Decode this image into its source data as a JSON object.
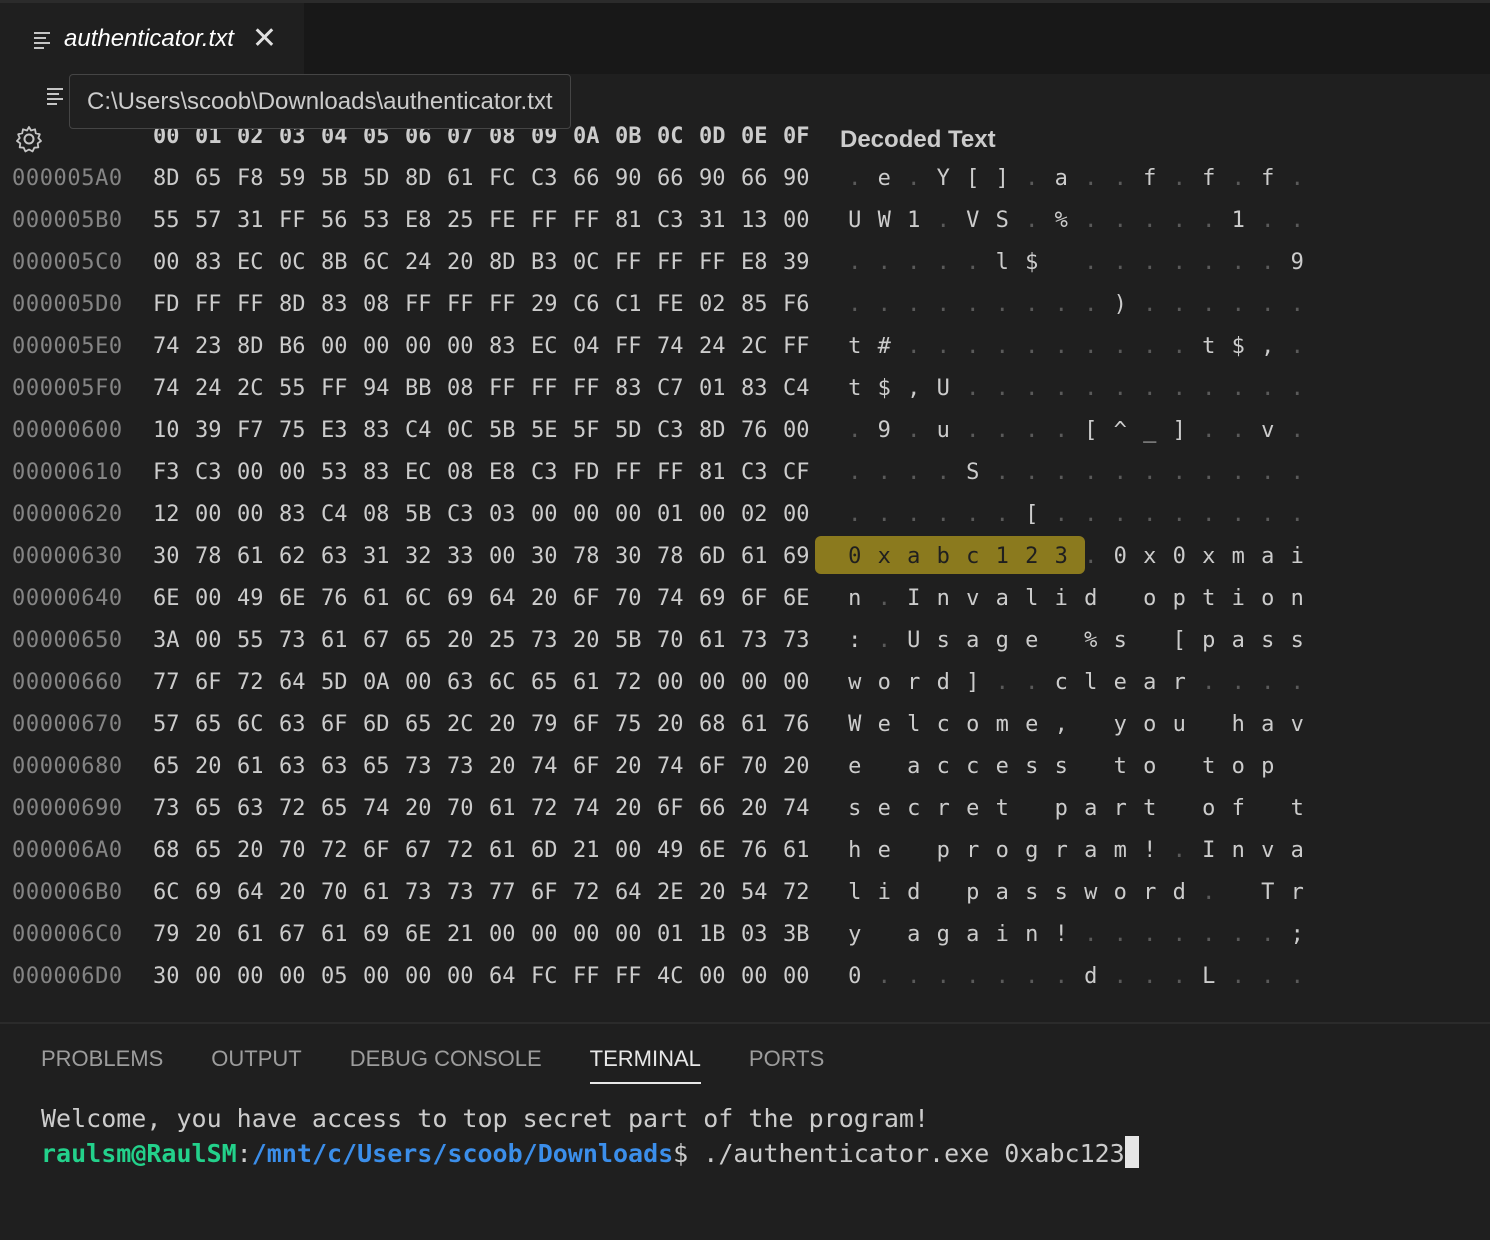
{
  "tab": {
    "title": "authenticator.txt",
    "close_glyph": "✕",
    "icon": "file-lines-icon"
  },
  "tooltip": {
    "path": "C:\\Users\\scoob\\Downloads\\authenticator.txt"
  },
  "hex_header": [
    "00",
    "01",
    "02",
    "03",
    "04",
    "05",
    "06",
    "07",
    "08",
    "09",
    "0A",
    "0B",
    "0C",
    "0D",
    "0E",
    "0F"
  ],
  "decoded_header": "Decoded Text",
  "rows": [
    {
      "addr": "000005A0",
      "hex": [
        "8D",
        "65",
        "F8",
        "59",
        "5B",
        "5D",
        "8D",
        "61",
        "FC",
        "C3",
        "66",
        "90",
        "66",
        "90",
        "66",
        "90"
      ],
      "dec": [
        ".",
        "e",
        ".",
        "Y",
        "[",
        "]",
        ".",
        "a",
        ".",
        ".",
        "f",
        ".",
        "f",
        ".",
        "f",
        "."
      ]
    },
    {
      "addr": "000005B0",
      "hex": [
        "55",
        "57",
        "31",
        "FF",
        "56",
        "53",
        "E8",
        "25",
        "FE",
        "FF",
        "FF",
        "81",
        "C3",
        "31",
        "13",
        "00"
      ],
      "dec": [
        "U",
        "W",
        "1",
        ".",
        "V",
        "S",
        ".",
        "%",
        ".",
        ".",
        ".",
        ".",
        ".",
        "1",
        ".",
        "."
      ]
    },
    {
      "addr": "000005C0",
      "hex": [
        "00",
        "83",
        "EC",
        "0C",
        "8B",
        "6C",
        "24",
        "20",
        "8D",
        "B3",
        "0C",
        "FF",
        "FF",
        "FF",
        "E8",
        "39"
      ],
      "dec": [
        ".",
        ".",
        ".",
        ".",
        ".",
        "l",
        "$",
        " ",
        ".",
        ".",
        ".",
        ".",
        ".",
        ".",
        ".",
        "9"
      ]
    },
    {
      "addr": "000005D0",
      "hex": [
        "FD",
        "FF",
        "FF",
        "8D",
        "83",
        "08",
        "FF",
        "FF",
        "FF",
        "29",
        "C6",
        "C1",
        "FE",
        "02",
        "85",
        "F6"
      ],
      "dec": [
        ".",
        ".",
        ".",
        ".",
        ".",
        ".",
        ".",
        ".",
        ".",
        ")",
        ".",
        ".",
        ".",
        ".",
        ".",
        "."
      ]
    },
    {
      "addr": "000005E0",
      "hex": [
        "74",
        "23",
        "8D",
        "B6",
        "00",
        "00",
        "00",
        "00",
        "83",
        "EC",
        "04",
        "FF",
        "74",
        "24",
        "2C",
        "FF"
      ],
      "dec": [
        "t",
        "#",
        ".",
        ".",
        ".",
        ".",
        ".",
        ".",
        ".",
        ".",
        ".",
        ".",
        "t",
        "$",
        ",",
        "."
      ]
    },
    {
      "addr": "000005F0",
      "hex": [
        "74",
        "24",
        "2C",
        "55",
        "FF",
        "94",
        "BB",
        "08",
        "FF",
        "FF",
        "FF",
        "83",
        "C7",
        "01",
        "83",
        "C4"
      ],
      "dec": [
        "t",
        "$",
        ",",
        "U",
        ".",
        ".",
        ".",
        ".",
        ".",
        ".",
        ".",
        ".",
        ".",
        ".",
        ".",
        "."
      ]
    },
    {
      "addr": "00000600",
      "hex": [
        "10",
        "39",
        "F7",
        "75",
        "E3",
        "83",
        "C4",
        "0C",
        "5B",
        "5E",
        "5F",
        "5D",
        "C3",
        "8D",
        "76",
        "00"
      ],
      "dec": [
        ".",
        "9",
        ".",
        "u",
        ".",
        ".",
        ".",
        ".",
        "[",
        "^",
        "_",
        "]",
        ".",
        ".",
        "v",
        "."
      ]
    },
    {
      "addr": "00000610",
      "hex": [
        "F3",
        "C3",
        "00",
        "00",
        "53",
        "83",
        "EC",
        "08",
        "E8",
        "C3",
        "FD",
        "FF",
        "FF",
        "81",
        "C3",
        "CF"
      ],
      "dec": [
        ".",
        ".",
        ".",
        ".",
        "S",
        ".",
        ".",
        ".",
        ".",
        ".",
        ".",
        ".",
        ".",
        ".",
        ".",
        "."
      ]
    },
    {
      "addr": "00000620",
      "hex": [
        "12",
        "00",
        "00",
        "83",
        "C4",
        "08",
        "5B",
        "C3",
        "03",
        "00",
        "00",
        "00",
        "01",
        "00",
        "02",
        "00"
      ],
      "dec": [
        ".",
        ".",
        ".",
        ".",
        ".",
        ".",
        "[",
        ".",
        ".",
        ".",
        ".",
        ".",
        ".",
        ".",
        ".",
        "."
      ]
    },
    {
      "addr": "00000630",
      "hex": [
        "30",
        "78",
        "61",
        "62",
        "63",
        "31",
        "32",
        "33",
        "00",
        "30",
        "78",
        "30",
        "78",
        "6D",
        "61",
        "69"
      ],
      "dec": [
        "0",
        "x",
        "a",
        "b",
        "c",
        "1",
        "2",
        "3",
        ".",
        "0",
        "x",
        "0",
        "x",
        "m",
        "a",
        "i"
      ]
    },
    {
      "addr": "00000640",
      "hex": [
        "6E",
        "00",
        "49",
        "6E",
        "76",
        "61",
        "6C",
        "69",
        "64",
        "20",
        "6F",
        "70",
        "74",
        "69",
        "6F",
        "6E"
      ],
      "dec": [
        "n",
        ".",
        "I",
        "n",
        "v",
        "a",
        "l",
        "i",
        "d",
        " ",
        "o",
        "p",
        "t",
        "i",
        "o",
        "n"
      ]
    },
    {
      "addr": "00000650",
      "hex": [
        "3A",
        "00",
        "55",
        "73",
        "61",
        "67",
        "65",
        "20",
        "25",
        "73",
        "20",
        "5B",
        "70",
        "61",
        "73",
        "73"
      ],
      "dec": [
        ":",
        ".",
        "U",
        "s",
        "a",
        "g",
        "e",
        " ",
        "%",
        "s",
        " ",
        "[",
        "p",
        "a",
        "s",
        "s"
      ]
    },
    {
      "addr": "00000660",
      "hex": [
        "77",
        "6F",
        "72",
        "64",
        "5D",
        "0A",
        "00",
        "63",
        "6C",
        "65",
        "61",
        "72",
        "00",
        "00",
        "00",
        "00"
      ],
      "dec": [
        "w",
        "o",
        "r",
        "d",
        "]",
        ".",
        ".",
        "c",
        "l",
        "e",
        "a",
        "r",
        ".",
        ".",
        ".",
        "."
      ]
    },
    {
      "addr": "00000670",
      "hex": [
        "57",
        "65",
        "6C",
        "63",
        "6F",
        "6D",
        "65",
        "2C",
        "20",
        "79",
        "6F",
        "75",
        "20",
        "68",
        "61",
        "76"
      ],
      "dec": [
        "W",
        "e",
        "l",
        "c",
        "o",
        "m",
        "e",
        ",",
        " ",
        "y",
        "o",
        "u",
        " ",
        "h",
        "a",
        "v"
      ]
    },
    {
      "addr": "00000680",
      "hex": [
        "65",
        "20",
        "61",
        "63",
        "63",
        "65",
        "73",
        "73",
        "20",
        "74",
        "6F",
        "20",
        "74",
        "6F",
        "70",
        "20"
      ],
      "dec": [
        "e",
        " ",
        "a",
        "c",
        "c",
        "e",
        "s",
        "s",
        " ",
        "t",
        "o",
        " ",
        "t",
        "o",
        "p",
        " "
      ]
    },
    {
      "addr": "00000690",
      "hex": [
        "73",
        "65",
        "63",
        "72",
        "65",
        "74",
        "20",
        "70",
        "61",
        "72",
        "74",
        "20",
        "6F",
        "66",
        "20",
        "74"
      ],
      "dec": [
        "s",
        "e",
        "c",
        "r",
        "e",
        "t",
        " ",
        "p",
        "a",
        "r",
        "t",
        " ",
        "o",
        "f",
        " ",
        "t"
      ]
    },
    {
      "addr": "000006A0",
      "hex": [
        "68",
        "65",
        "20",
        "70",
        "72",
        "6F",
        "67",
        "72",
        "61",
        "6D",
        "21",
        "00",
        "49",
        "6E",
        "76",
        "61"
      ],
      "dec": [
        "h",
        "e",
        " ",
        "p",
        "r",
        "o",
        "g",
        "r",
        "a",
        "m",
        "!",
        ".",
        "I",
        "n",
        "v",
        "a"
      ]
    },
    {
      "addr": "000006B0",
      "hex": [
        "6C",
        "69",
        "64",
        "20",
        "70",
        "61",
        "73",
        "73",
        "77",
        "6F",
        "72",
        "64",
        "2E",
        "20",
        "54",
        "72"
      ],
      "dec": [
        "l",
        "i",
        "d",
        " ",
        "p",
        "a",
        "s",
        "s",
        "w",
        "o",
        "r",
        "d",
        ".",
        " ",
        "T",
        "r"
      ]
    },
    {
      "addr": "000006C0",
      "hex": [
        "79",
        "20",
        "61",
        "67",
        "61",
        "69",
        "6E",
        "21",
        "00",
        "00",
        "00",
        "00",
        "01",
        "1B",
        "03",
        "3B"
      ],
      "dec": [
        "y",
        " ",
        "a",
        "g",
        "a",
        "i",
        "n",
        "!",
        ".",
        ".",
        ".",
        ".",
        ".",
        ".",
        ".",
        ";"
      ]
    },
    {
      "addr": "000006D0",
      "hex": [
        "30",
        "00",
        "00",
        "00",
        "05",
        "00",
        "00",
        "00",
        "64",
        "FC",
        "FF",
        "FF",
        "4C",
        "00",
        "00",
        "00"
      ],
      "dec": [
        "0",
        ".",
        ".",
        ".",
        ".",
        ".",
        ".",
        ".",
        "d",
        ".",
        ".",
        ".",
        "L",
        ".",
        ".",
        "."
      ]
    }
  ],
  "highlight": {
    "row": 9,
    "cells": [
      0,
      1,
      2,
      3,
      4,
      5,
      6,
      7
    ],
    "color": "#8b7a1e"
  },
  "panel": {
    "tabs": [
      "PROBLEMS",
      "OUTPUT",
      "DEBUG CONSOLE",
      "TERMINAL",
      "PORTS"
    ],
    "active_tab": "TERMINAL"
  },
  "terminal": {
    "line1": "Welcome, you have access to top secret part of the program!",
    "user": "raulsm@RaulSM",
    "sep": ":",
    "path": "/mnt/c/Users/scoob/Downloads",
    "prompt": "$ ",
    "command": "./authenticator.exe 0xabc123"
  },
  "colors": {
    "user": "#23d18b",
    "path": "#3b8eea",
    "highlight": "#8b7a1e"
  }
}
